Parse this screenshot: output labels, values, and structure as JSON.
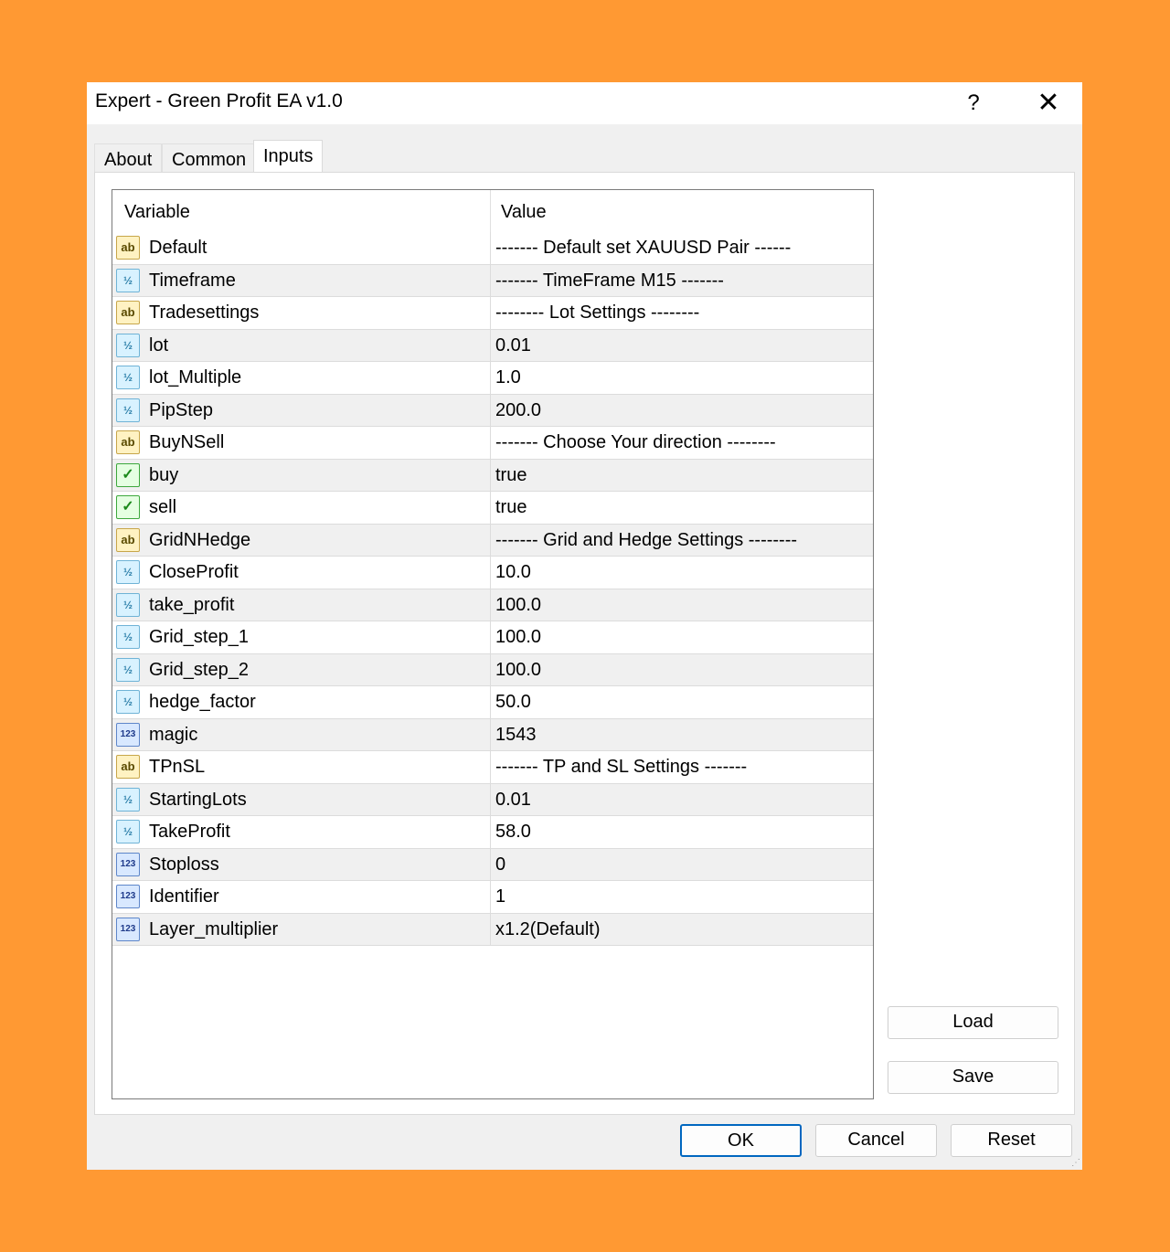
{
  "window": {
    "title": "Expert - Green Profit EA v1.0",
    "help_label": "?",
    "close_label": "✕"
  },
  "tabs": [
    {
      "label": "About"
    },
    {
      "label": "Common"
    },
    {
      "label": "Inputs"
    }
  ],
  "active_tab": "Inputs",
  "grid": {
    "columns": {
      "variable": "Variable",
      "value": "Value"
    },
    "rows": [
      {
        "icon": "ab",
        "variable": "Default",
        "value": "-------  Default set XAUUSD Pair  ------"
      },
      {
        "icon": "v2",
        "variable": "Timeframe",
        "value": "-------  TimeFrame M15  -------"
      },
      {
        "icon": "ab",
        "variable": "Tradesettings",
        "value": "--------  Lot Settings  --------"
      },
      {
        "icon": "v2",
        "variable": "lot",
        "value": "0.01"
      },
      {
        "icon": "v2",
        "variable": "lot_Multiple",
        "value": "1.0"
      },
      {
        "icon": "v2",
        "variable": "PipStep",
        "value": "200.0"
      },
      {
        "icon": "ab",
        "variable": "BuyNSell",
        "value": "-------  Choose Your direction  --------"
      },
      {
        "icon": "chk",
        "variable": "buy",
        "value": "true"
      },
      {
        "icon": "chk",
        "variable": "sell",
        "value": "true"
      },
      {
        "icon": "ab",
        "variable": "GridNHedge",
        "value": "-------  Grid and Hedge Settings  --------"
      },
      {
        "icon": "v2",
        "variable": "CloseProfit",
        "value": "10.0"
      },
      {
        "icon": "v2",
        "variable": "take_profit",
        "value": "100.0"
      },
      {
        "icon": "v2",
        "variable": "Grid_step_1",
        "value": "100.0"
      },
      {
        "icon": "v2",
        "variable": "Grid_step_2",
        "value": "100.0"
      },
      {
        "icon": "v2",
        "variable": "hedge_factor",
        "value": "50.0"
      },
      {
        "icon": "123",
        "variable": "magic",
        "value": "1543"
      },
      {
        "icon": "ab",
        "variable": "TPnSL",
        "value": "-------  TP and SL Settings  -------"
      },
      {
        "icon": "v2",
        "variable": "StartingLots",
        "value": "0.01"
      },
      {
        "icon": "v2",
        "variable": "TakeProfit",
        "value": "58.0"
      },
      {
        "icon": "123",
        "variable": "Stoploss",
        "value": "0"
      },
      {
        "icon": "123",
        "variable": "Identifier",
        "value": "1"
      },
      {
        "icon": "123",
        "variable": "Layer_multiplier",
        "value": "x1.2(Default)"
      }
    ]
  },
  "icon_glyphs": {
    "ab": "ab",
    "v2": "½",
    "123": "123",
    "chk": "✓"
  },
  "buttons": {
    "load": "Load",
    "save": "Save",
    "ok": "OK",
    "cancel": "Cancel",
    "reset": "Reset"
  },
  "colors": {
    "background": "#FF9933",
    "ok_border": "#0067C0"
  }
}
